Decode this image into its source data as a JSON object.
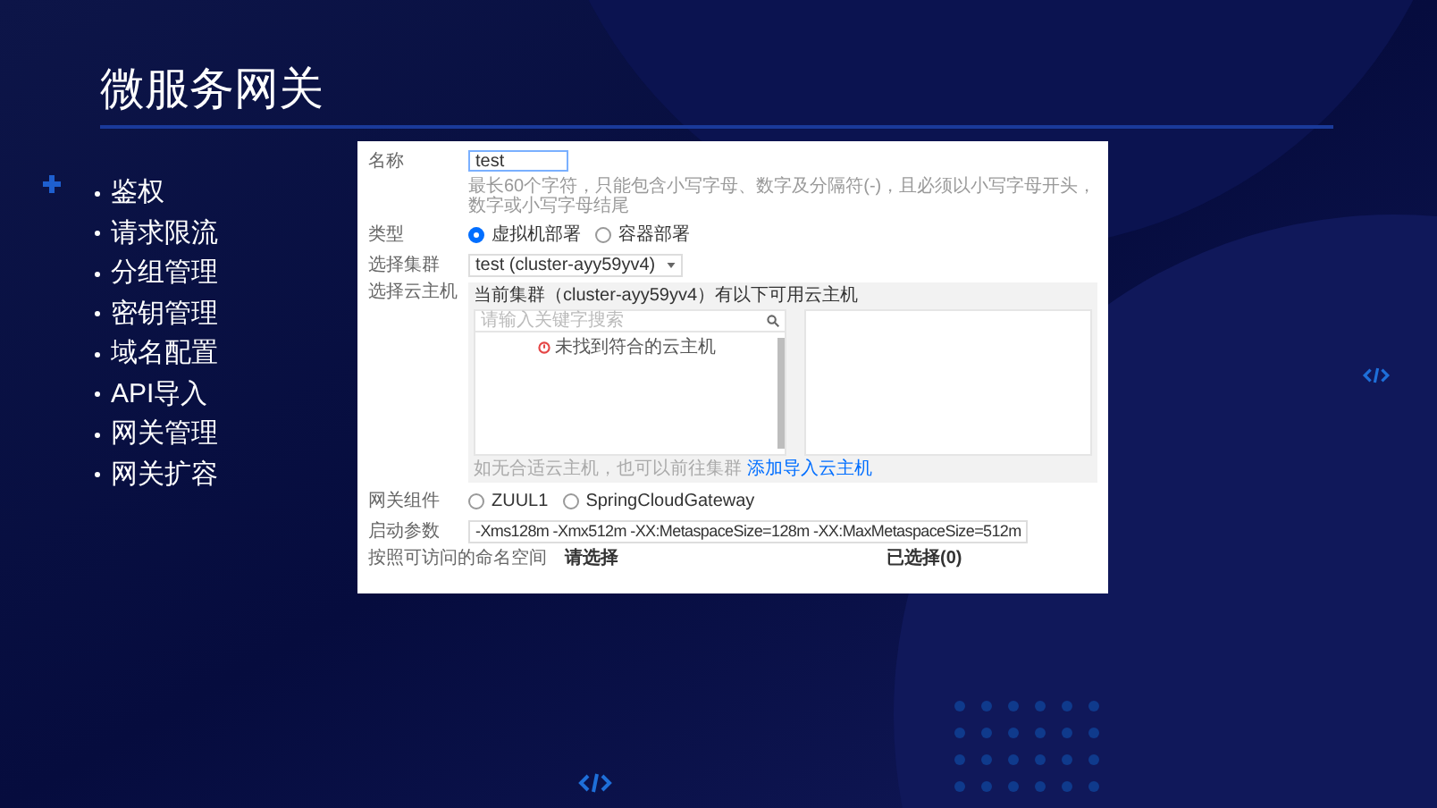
{
  "slide": {
    "title": "微服务网关",
    "bullets": [
      "鉴权",
      "请求限流",
      "分组管理",
      "密钥管理",
      "域名配置",
      "API导入",
      "网关管理",
      "网关扩容"
    ]
  },
  "screenshot": {
    "name": {
      "label": "名称",
      "value": "test",
      "hint": "最长60个字符，只能包含小写字母、数字及分隔符(-)，且必须以小写字母开头，数字或小写字母结尾"
    },
    "type": {
      "label": "类型",
      "options": [
        {
          "label": "虚拟机部署",
          "selected": true
        },
        {
          "label": "容器部署",
          "selected": false
        }
      ]
    },
    "cluster": {
      "label": "选择集群",
      "value": "test (cluster-ayy59yv4)"
    },
    "machines": {
      "label": "选择云主机",
      "header": "当前集群（cluster-ayy59yv4）有以下可用云主机",
      "search_placeholder": "请输入关键字搜索",
      "empty": "未找到符合的云主机",
      "note": "如无合适云主机，也可以前往集群",
      "note_link": "添加导入云主机"
    },
    "component": {
      "label": "网关组件",
      "options": [
        {
          "label": "ZUUL1",
          "selected": false
        },
        {
          "label": "SpringCloudGateway",
          "selected": false
        }
      ]
    },
    "params": {
      "label": "启动参数",
      "value": "-Xms128m -Xmx512m -XX:MetaspaceSize=128m -XX:MaxMetaspaceSize=512m"
    },
    "namespaces": {
      "label": "按照可访问的命名空间",
      "left": "请选择",
      "right": "已选择(0)"
    }
  }
}
